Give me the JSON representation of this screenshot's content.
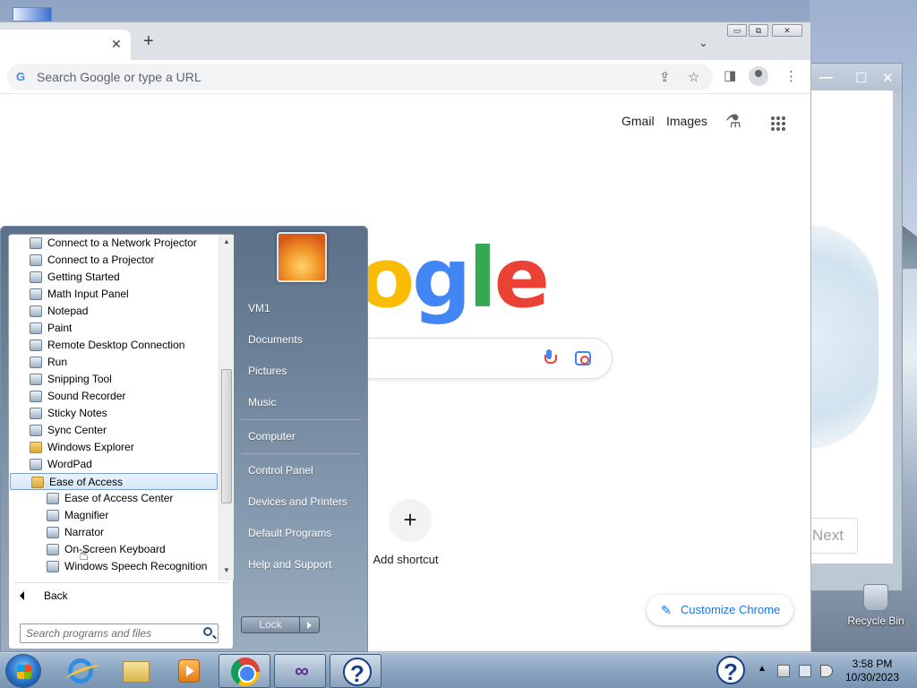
{
  "desktop": {
    "recycle_bin": "Recycle Bin"
  },
  "background_window": {
    "next_label": "Next"
  },
  "chrome": {
    "new_tab": "+",
    "omnibox_placeholder": "Search Google or type a URL",
    "links": {
      "gmail": "Gmail",
      "images": "Images"
    },
    "logo_visible_letters": "ogle",
    "add_shortcut_label": "Add shortcut",
    "customize_label": "Customize Chrome",
    "accent_color": "#1a73e8"
  },
  "start_menu": {
    "programs": [
      {
        "label": "Connect to a Network Projector",
        "icon": "projector-icon",
        "level": 1
      },
      {
        "label": "Connect to a Projector",
        "icon": "monitor-icon",
        "level": 1
      },
      {
        "label": "Getting Started",
        "icon": "getting-started-icon",
        "level": 1
      },
      {
        "label": "Math Input Panel",
        "icon": "math-input-icon",
        "level": 1
      },
      {
        "label": "Notepad",
        "icon": "notepad-icon",
        "level": 1
      },
      {
        "label": "Paint",
        "icon": "paint-icon",
        "level": 1
      },
      {
        "label": "Remote Desktop Connection",
        "icon": "remote-desktop-icon",
        "level": 1
      },
      {
        "label": "Run",
        "icon": "run-icon",
        "level": 1
      },
      {
        "label": "Snipping Tool",
        "icon": "snipping-tool-icon",
        "level": 1
      },
      {
        "label": "Sound Recorder",
        "icon": "microphone-icon",
        "level": 1
      },
      {
        "label": "Sticky Notes",
        "icon": "sticky-notes-icon",
        "level": 1
      },
      {
        "label": "Sync Center",
        "icon": "sync-icon",
        "level": 1
      },
      {
        "label": "Windows Explorer",
        "icon": "folder-icon",
        "level": 1
      },
      {
        "label": "WordPad",
        "icon": "wordpad-icon",
        "level": 1
      },
      {
        "label": "Ease of Access",
        "icon": "folder-icon",
        "level": 1,
        "selected": true
      },
      {
        "label": "Ease of Access Center",
        "icon": "ease-of-access-icon",
        "level": 2
      },
      {
        "label": "Magnifier",
        "icon": "magnifier-icon",
        "level": 2
      },
      {
        "label": "Narrator",
        "icon": "narrator-icon",
        "level": 2
      },
      {
        "label": "On-Screen Keyboard",
        "icon": "keyboard-icon",
        "level": 2
      },
      {
        "label": "Windows Speech Recognition",
        "icon": "microphone-icon",
        "level": 2
      }
    ],
    "back_label": "Back",
    "search_placeholder": "Search programs and files",
    "right_items": {
      "user": "VM1",
      "documents": "Documents",
      "pictures": "Pictures",
      "music": "Music",
      "computer": "Computer",
      "control_panel": "Control Panel",
      "devices": "Devices and Printers",
      "default_programs": "Default Programs",
      "help": "Help and Support"
    },
    "lock_label": "Lock"
  },
  "taskbar": {
    "pinned": [
      "internet-explorer-icon",
      "windows-explorer-icon",
      "media-player-icon",
      "chrome-icon",
      "visual-studio-icon",
      "help-icon"
    ],
    "active": "chrome-icon",
    "clock_time": "3:58 PM",
    "clock_date": "10/30/2023"
  }
}
